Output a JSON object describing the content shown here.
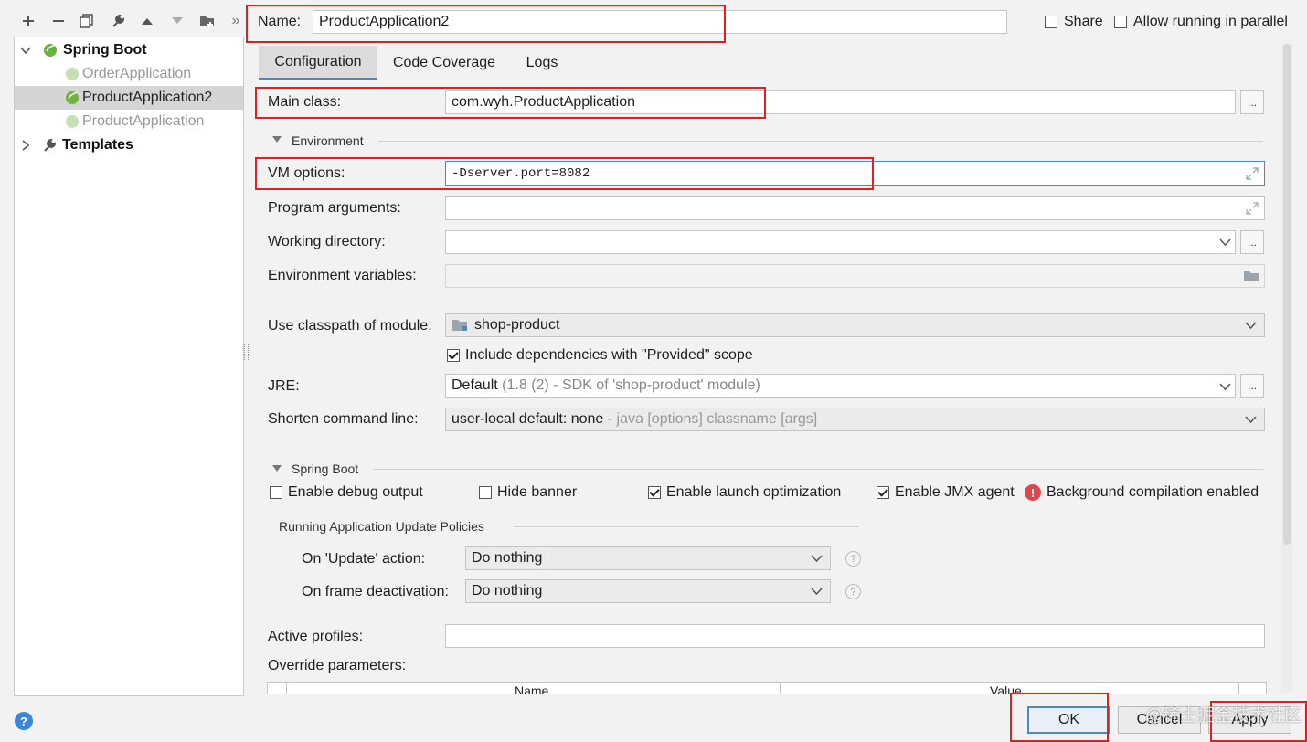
{
  "toolbar": {
    "items": [
      "add-icon",
      "remove-icon",
      "copy-icon",
      "wrench-icon",
      "move-up-icon",
      "move-down-icon",
      "add-folder-icon",
      "more-icon"
    ],
    "overflow_label": "»"
  },
  "tree": {
    "root": "Spring Boot",
    "children": [
      "OrderApplication",
      "ProductApplication2",
      "ProductApplication"
    ],
    "selected": "ProductApplication2",
    "templates": "Templates"
  },
  "name": {
    "label": "Name:",
    "value": "ProductApplication2"
  },
  "options": {
    "share": "Share",
    "share_checked": false,
    "parallel": "Allow running in parallel",
    "parallel_checked": false
  },
  "tabs": [
    "Configuration",
    "Code Coverage",
    "Logs"
  ],
  "active_tab": "Configuration",
  "config": {
    "main_class_label": "Main class:",
    "main_class_value": "com.wyh.ProductApplication",
    "browse_label": "...",
    "environment_section": "Environment",
    "vm_options_label": "VM options:",
    "vm_options_value": "-Dserver.port=8082",
    "program_args_label": "Program arguments:",
    "working_dir_label": "Working directory:",
    "env_vars_label": "Environment variables:",
    "classpath_label": "Use classpath of module:",
    "classpath_value": "shop-product",
    "include_deps_label": "Include dependencies with \"Provided\" scope",
    "include_deps_checked": true,
    "jre_label": "JRE:",
    "jre_value": "Default",
    "jre_detail": "(1.8 (2) - SDK of 'shop-product' module)",
    "shorten_label": "Shorten command line:",
    "shorten_value": "user-local default: none",
    "shorten_detail": "- java [options] classname [args]"
  },
  "spring_boot": {
    "section": "Spring Boot",
    "debug_label": "Enable debug output",
    "debug_checked": false,
    "hide_banner_label": "Hide banner",
    "hide_banner_checked": false,
    "launch_opt_label": "Enable launch optimization",
    "launch_opt_checked": true,
    "jmx_label": "Enable JMX agent",
    "jmx_checked": true,
    "bg_compilation_label": "Background compilation enabled",
    "policies_section": "Running Application Update Policies",
    "update_action_label": "On 'Update' action:",
    "update_action_value": "Do nothing",
    "frame_deactivation_label": "On frame deactivation:",
    "frame_deactivation_value": "Do nothing",
    "help_glyph": "?",
    "active_profiles_label": "Active profiles:",
    "override_params_label": "Override parameters:",
    "table_headers": [
      "Name",
      "Value"
    ]
  },
  "buttons": {
    "ok": "OK",
    "cancel": "Cancel",
    "apply": "Apply",
    "help": "?"
  },
  "watermark": "@稀土掘金技术社区",
  "colors": {
    "accent": "#4a88c7",
    "highlight_box": "#e02020",
    "selection": "#d5d5d5",
    "spring_green": "#6db33f",
    "error_red": "#e0454b"
  }
}
